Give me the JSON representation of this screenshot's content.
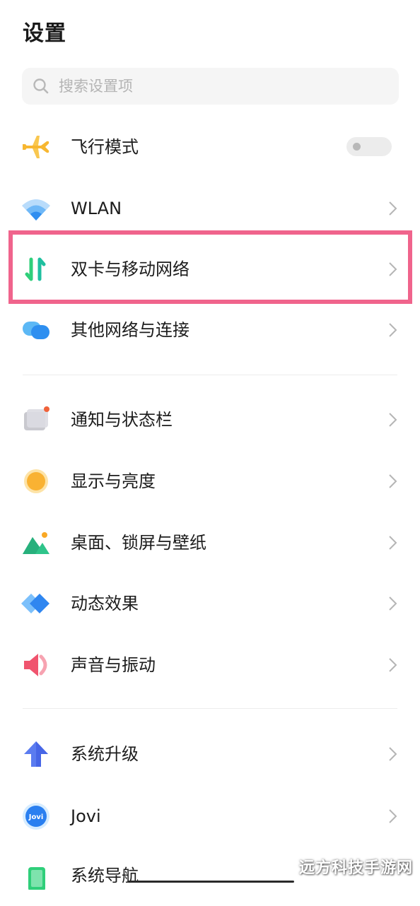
{
  "header": {
    "title": "设置"
  },
  "search": {
    "placeholder": "搜索设置项"
  },
  "items": [
    {
      "label": "飞行模式",
      "icon": "airplane-icon",
      "control": "toggle",
      "toggle_on": false
    },
    {
      "label": "WLAN",
      "icon": "wifi-icon",
      "control": "chevron"
    },
    {
      "label": "双卡与移动网络",
      "icon": "dual-sim-arrows-icon",
      "control": "chevron",
      "highlighted": true
    },
    {
      "label": "其他网络与连接",
      "icon": "connection-bubbles-icon",
      "control": "chevron"
    },
    {
      "label": "通知与状态栏",
      "icon": "notification-icon",
      "control": "chevron"
    },
    {
      "label": "显示与亮度",
      "icon": "brightness-sun-icon",
      "control": "chevron"
    },
    {
      "label": "桌面、锁屏与壁纸",
      "icon": "wallpaper-mountain-icon",
      "control": "chevron"
    },
    {
      "label": "动态效果",
      "icon": "motion-diamond-icon",
      "control": "chevron"
    },
    {
      "label": "声音与振动",
      "icon": "speaker-icon",
      "control": "chevron"
    },
    {
      "label": "系统升级",
      "icon": "upgrade-arrow-icon",
      "control": "chevron"
    },
    {
      "label": "Jovi",
      "icon": "jovi-icon",
      "control": "chevron"
    },
    {
      "label": "系统导航",
      "icon": "system-navigation-icon",
      "control": "chevron"
    }
  ],
  "icon_text": {
    "jovi": "Jovi"
  },
  "colors": {
    "highlight_border": "#f0648c",
    "airplane": "#f7b731",
    "wifi": "#3a9cf5"
  },
  "watermark": "远方科技手游网"
}
